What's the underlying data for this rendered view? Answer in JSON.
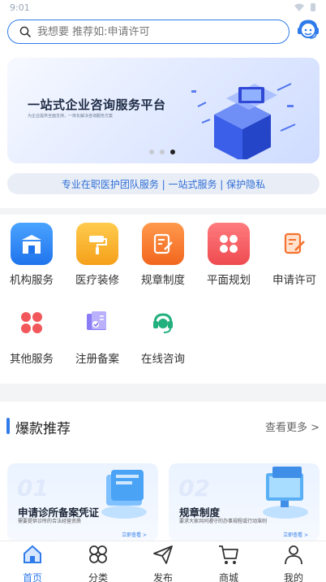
{
  "status_bar": {
    "time": "9:01"
  },
  "search": {
    "placeholder": "我想要 推荐如:申请许可"
  },
  "banner": {
    "title": "一站式企业咨询服务平台",
    "subtitle": "为企业提供全面支持，一体化解决咨询服务方案",
    "carousel_total": 3,
    "carousel_active": 3
  },
  "notice": {
    "text": "专业在职医护团队服务 | 一站式服务 | 保护隐私"
  },
  "services": [
    {
      "label": "机构服务",
      "icon": "building-icon",
      "color": "#2e86f5"
    },
    {
      "label": "医疗装修",
      "icon": "paint-roller-icon",
      "color": "#f5a623"
    },
    {
      "label": "规章制度",
      "icon": "document-edit-icon",
      "color": "#f5712e"
    },
    {
      "label": "平面规划",
      "icon": "grid-flower-icon",
      "color": "#f2575b"
    },
    {
      "label": "申请许可",
      "icon": "form-edit-icon",
      "color": "#f5712e"
    },
    {
      "label": "其他服务",
      "icon": "four-petals-icon",
      "color": "#f2575b"
    },
    {
      "label": "注册备案",
      "icon": "certificate-icon",
      "color": "#7b6cf0"
    },
    {
      "label": "在线咨询",
      "icon": "headset-icon",
      "color": "#22b07d"
    }
  ],
  "recommend": {
    "title": "爆款推荐",
    "more": "查看更多 >",
    "cards": [
      {
        "num": "01",
        "title": "申请诊所备案凭证",
        "desc": "需要提供诊所的合法经营资质",
        "link": "立即查看 >"
      },
      {
        "num": "02",
        "title": "规章制度",
        "desc": "要求大家共同遵守的办事规程或行动准则",
        "link": "立即查看 >"
      }
    ]
  },
  "tabbar": [
    {
      "label": "首页",
      "icon": "home-icon",
      "active": true
    },
    {
      "label": "分类",
      "icon": "category-icon",
      "active": false
    },
    {
      "label": "发布",
      "icon": "send-icon",
      "active": false
    },
    {
      "label": "商城",
      "icon": "cart-icon",
      "active": false
    },
    {
      "label": "我的",
      "icon": "user-icon",
      "active": false
    }
  ],
  "colors": {
    "accent": "#2f7bea",
    "notice_bg": "#e9edf6",
    "page_bg": "#f3f4f6"
  }
}
